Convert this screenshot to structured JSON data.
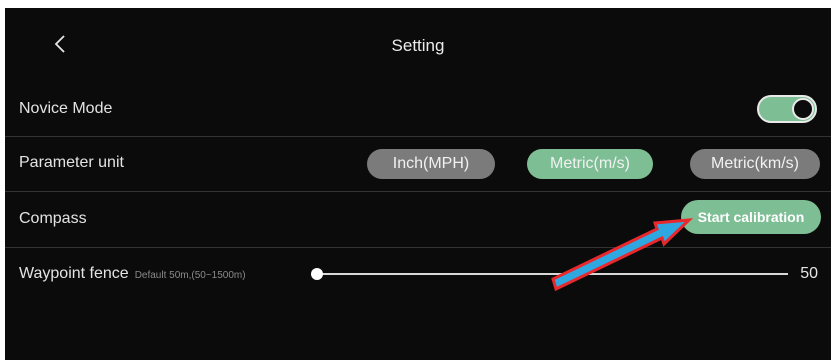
{
  "header": {
    "title": "Setting",
    "back_icon": "chevron-left-icon"
  },
  "settings": {
    "novice_mode": {
      "label": "Novice Mode",
      "enabled": true
    },
    "parameter_unit": {
      "label": "Parameter unit",
      "options": [
        "Inch(MPH)",
        "Metric(m/s)",
        "Metric(km/s)"
      ],
      "selected": "Metric(m/s)"
    },
    "compass": {
      "label": "Compass",
      "button_label": "Start calibration"
    },
    "waypoint_fence": {
      "label": "Waypoint fence",
      "hint": "Default 50m,(50~1500m)",
      "value": "50",
      "slider_fraction": 0.0
    }
  },
  "annotation": {
    "arrow_icon": "arrow-pointer-icon",
    "color": "#e8282c",
    "fill": "#2fa7e0"
  },
  "colors": {
    "accent": "#7dbe94",
    "inactive_pill": "#7b7b7b",
    "background": "#0b0b0b"
  }
}
